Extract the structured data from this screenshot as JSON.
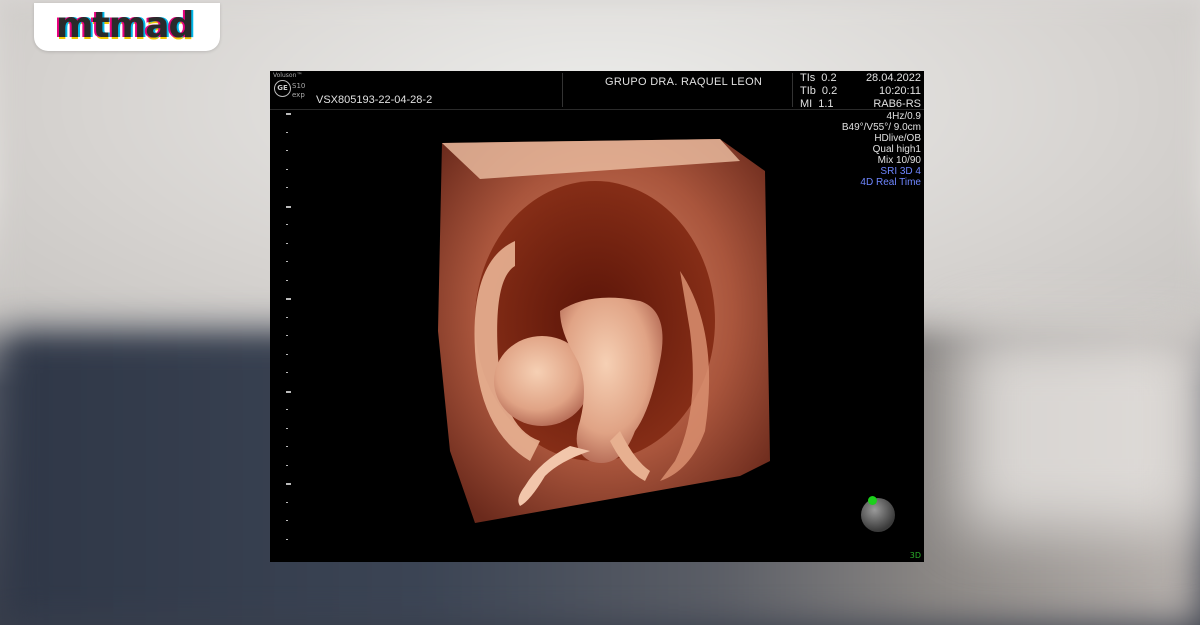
{
  "logo": {
    "text": "mtmad"
  },
  "scan": {
    "brand": "Voluson™",
    "model": "S10",
    "model_sub": "exp",
    "ge_mark": "GE",
    "patient_id": "VSX805193-22-04-28-2",
    "clinic": "GRUPO DRA. RAQUEL LEON",
    "indices": [
      {
        "label": "TIs",
        "value": "0.2"
      },
      {
        "label": "TIb",
        "value": "0.2"
      },
      {
        "label": "MI",
        "value": "1.1"
      }
    ],
    "date": "28.04.2022",
    "time": "10:20:11",
    "probe": "RAB6-RS",
    "params": [
      "4Hz/0.9",
      "B49°/V55°/ 9.0cm",
      "HDlive/OB",
      "Qual high1",
      "Mix 10/90"
    ],
    "params_blue": [
      "SRI 3D 4",
      "4D Real Time"
    ],
    "mode": "3D"
  }
}
